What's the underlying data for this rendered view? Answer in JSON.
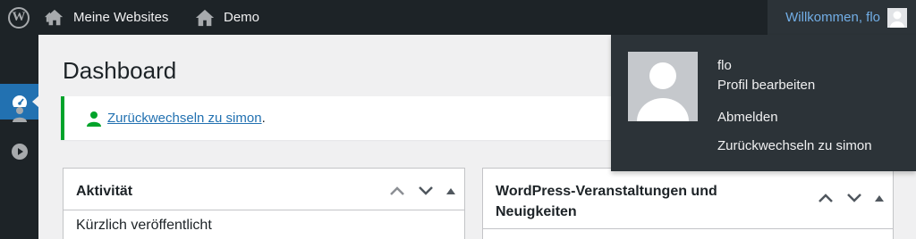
{
  "adminbar": {
    "sites_label": "Meine Websites",
    "demo_label": "Demo",
    "welcome_label": "Willkommen, flo"
  },
  "page": {
    "title": "Dashboard"
  },
  "notice": {
    "link_text": "Zurückwechseln zu simon",
    "suffix": "."
  },
  "boxes": {
    "activity": {
      "title": "Aktivität",
      "first_line": "Kürzlich veröffentlicht"
    },
    "events": {
      "title": "WordPress-Veranstaltungen und Neuigkeiten"
    }
  },
  "user_dropdown": {
    "username": "flo",
    "edit_profile": "Profil bearbeiten",
    "logout": "Abmelden",
    "switch_back": "Zurückwechseln zu simon"
  },
  "colors": {
    "adminbar_bg": "#1d2327",
    "accent": "#2271b1",
    "success": "#00a32a",
    "link": "#72aee6"
  }
}
